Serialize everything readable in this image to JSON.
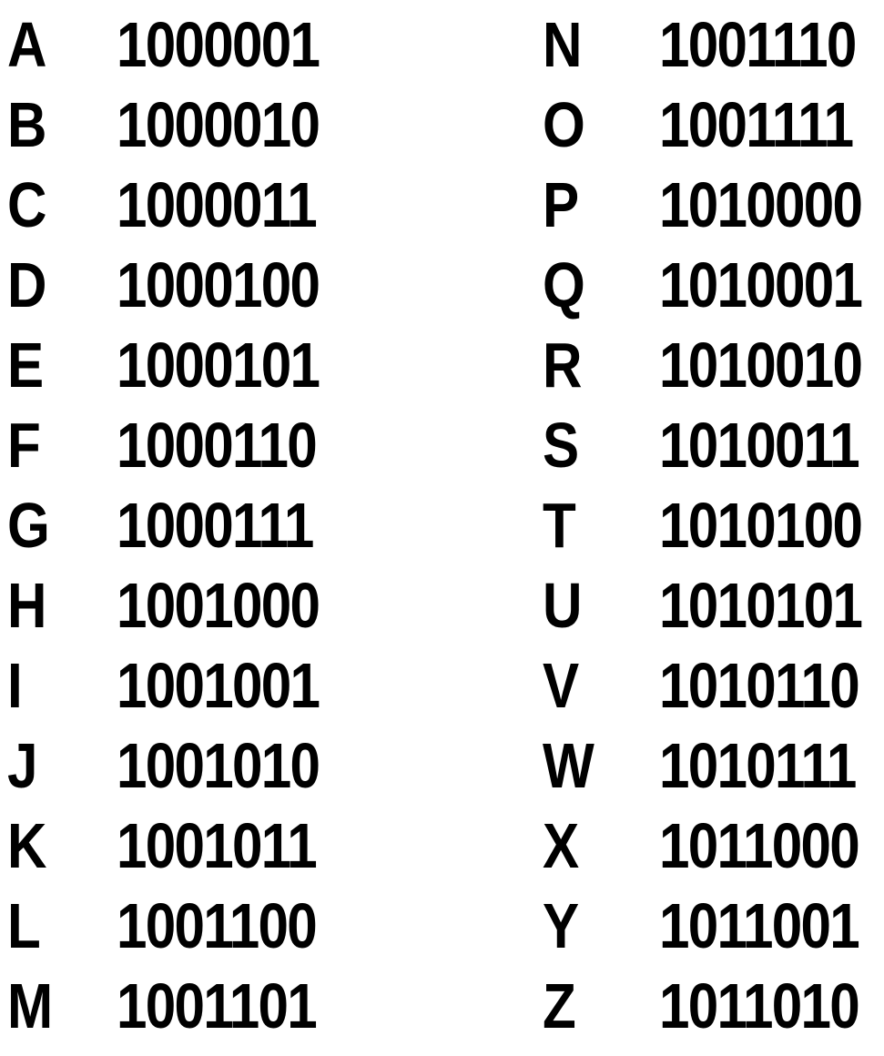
{
  "table": {
    "left": [
      {
        "letter": "A",
        "code": "1000001"
      },
      {
        "letter": "B",
        "code": "1000010"
      },
      {
        "letter": "C",
        "code": "1000011"
      },
      {
        "letter": "D",
        "code": "1000100"
      },
      {
        "letter": "E",
        "code": "1000101"
      },
      {
        "letter": "F",
        "code": "1000110"
      },
      {
        "letter": "G",
        "code": "1000111"
      },
      {
        "letter": "H",
        "code": "1001000"
      },
      {
        "letter": "I",
        "code": "1001001"
      },
      {
        "letter": "J",
        "code": "1001010"
      },
      {
        "letter": "K",
        "code": "1001011"
      },
      {
        "letter": "L",
        "code": "1001100"
      },
      {
        "letter": "M",
        "code": "1001101"
      }
    ],
    "right": [
      {
        "letter": "N",
        "code": "1001110"
      },
      {
        "letter": "O",
        "code": "1001111"
      },
      {
        "letter": "P",
        "code": "1010000"
      },
      {
        "letter": "Q",
        "code": "1010001"
      },
      {
        "letter": "R",
        "code": "1010010"
      },
      {
        "letter": "S",
        "code": "1010011"
      },
      {
        "letter": "T",
        "code": "1010100"
      },
      {
        "letter": "U",
        "code": "1010101"
      },
      {
        "letter": "V",
        "code": "1010110"
      },
      {
        "letter": "W",
        "code": "1010111"
      },
      {
        "letter": "X",
        "code": "1011000"
      },
      {
        "letter": "Y",
        "code": "1011001"
      },
      {
        "letter": "Z",
        "code": "1011010"
      }
    ]
  }
}
